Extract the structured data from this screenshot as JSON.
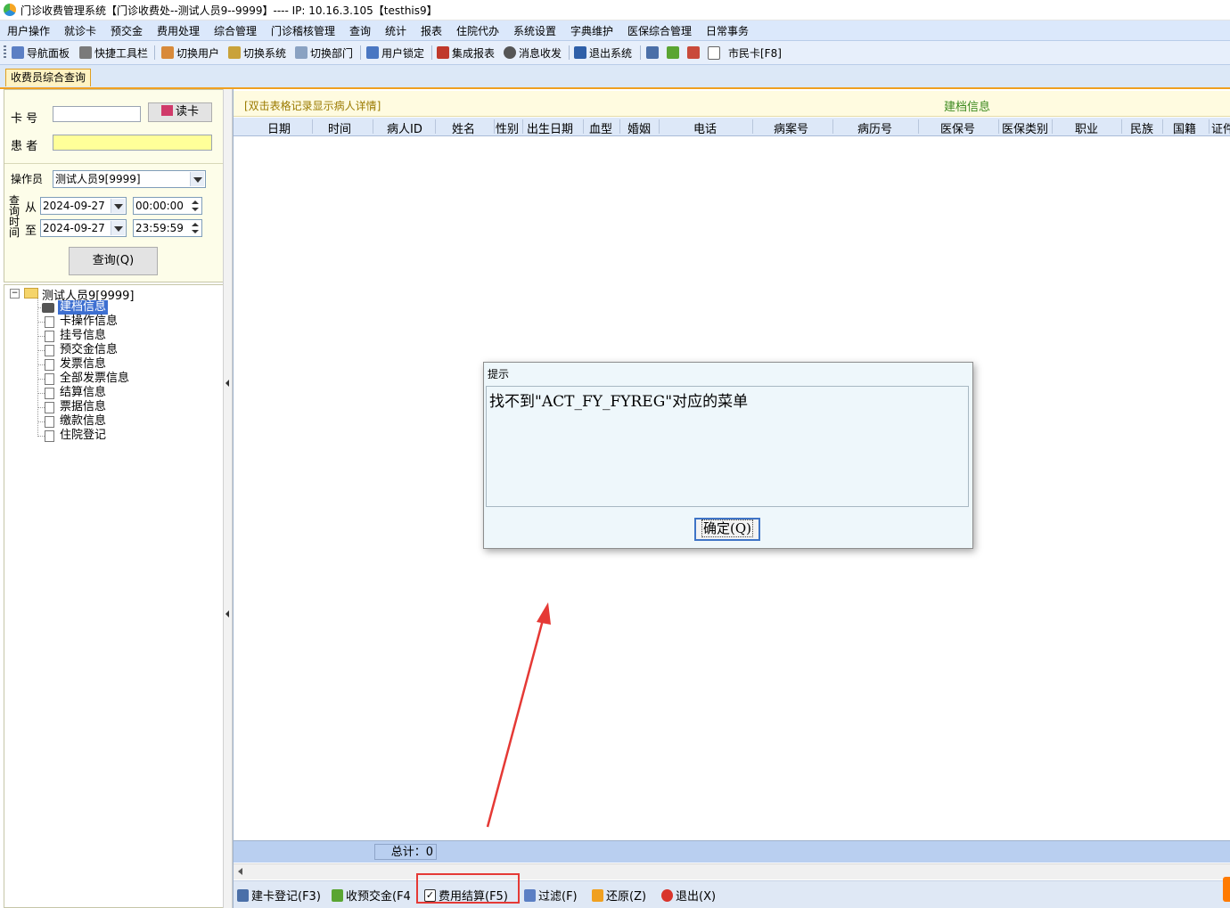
{
  "window": {
    "title": "门诊收费管理系统【门诊收费处--测试人员9--9999】---- IP:  10.16.3.105【testhis9】"
  },
  "menu": [
    "用户操作",
    "就诊卡",
    "预交金",
    "费用处理",
    "综合管理",
    "门诊稽核管理",
    "查询",
    "统计",
    "报表",
    "住院代办",
    "系统设置",
    "字典维护",
    "医保综合管理",
    "日常事务"
  ],
  "toolbar": {
    "items": [
      "导航面板",
      "快捷工具栏",
      "切换用户",
      "切换系统",
      "切换部门",
      "用户锁定",
      "集成报表",
      "消息收发",
      "退出系统",
      "市民卡[F8]"
    ]
  },
  "tab": {
    "label": "收费员综合查询"
  },
  "left": {
    "card_label": "卡  号",
    "read_card": "读卡",
    "patient_label": "患  者",
    "operator_label": "操作员",
    "operator_value": "测试人员9[9999]",
    "query_time_label": [
      "查",
      "询",
      "时",
      "间"
    ],
    "from_label": "从",
    "to_label": "至",
    "from_date": "2024-09-27",
    "from_time": "00:00:00",
    "to_date": "2024-09-27",
    "to_time": "23:59:59",
    "query_button": "查询(Q)"
  },
  "tree": {
    "root": "测试人员9[9999]",
    "items": [
      "建档信息",
      "卡操作信息",
      "挂号信息",
      "预交金信息",
      "发票信息",
      "全部发票信息",
      "结算信息",
      "票据信息",
      "缴款信息",
      "住院登记"
    ],
    "selected_index": 0
  },
  "grid": {
    "hint": "[双击表格记录显示病人详情]",
    "title": "建档信息",
    "columns": [
      "日期",
      "时间",
      "病人ID",
      "姓名",
      "性别",
      "出生日期",
      "血型",
      "婚姻",
      "电话",
      "病案号",
      "病历号",
      "医保号",
      "医保类别",
      "职业",
      "民族",
      "国籍",
      "证件"
    ],
    "total": "总计：0"
  },
  "bottom": {
    "buttons": [
      "建卡登记(F3)",
      "收预交金(F4",
      "费用结算(F5)",
      "过滤(F)",
      "还原(Z)",
      "退出(X)"
    ],
    "checked": "费用结算(F5)"
  },
  "dialog": {
    "title": "提示",
    "message": "找不到\"ACT_FY_FYREG\"对应的菜单",
    "ok": "确定(Q)"
  },
  "colors": {
    "annotation": "#e53935",
    "menu_bg": "#dbe8fb",
    "panel_bg": "#fdfde9"
  }
}
